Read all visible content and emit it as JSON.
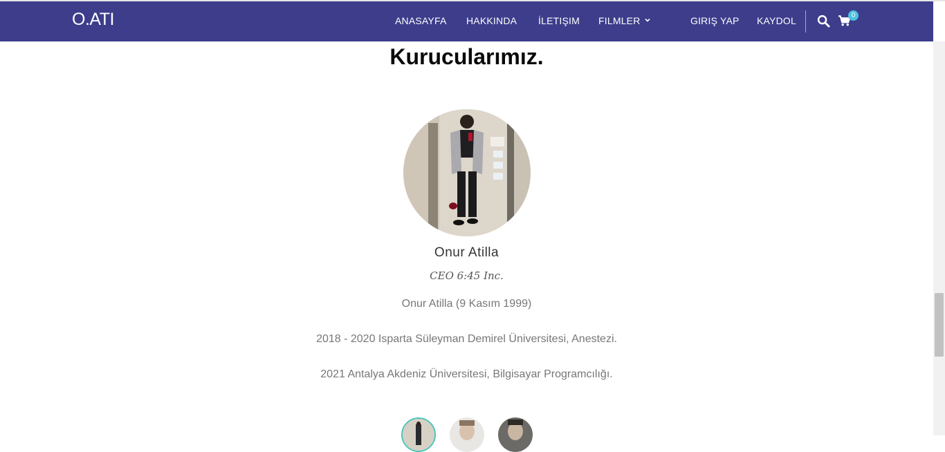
{
  "brand": {
    "logo": "O.ATI",
    "nav_color": "#3d3d8c",
    "accent": "#4cc3e0"
  },
  "nav": {
    "items": [
      {
        "label": "ANASAYFA"
      },
      {
        "label": "HAKKINDA"
      },
      {
        "label": "İLETIŞIM"
      },
      {
        "label": "FILMLER"
      }
    ],
    "login": "GIRIŞ YAP",
    "register": "KAYDOL",
    "icons": [
      "search-icon",
      "cart-icon",
      "chevron-down-icon"
    ],
    "cart_count": "0"
  },
  "section": {
    "title": "Kurucularımız.",
    "founder": {
      "name": "Onur Atilla",
      "role": "CEO 6:45 Inc.",
      "bio": [
        "Onur Atilla (9 Kasım 1999)",
        "2018 - 2020 Isparta Süleyman Demirel Üniversitesi, Anestezi.",
        "2021 Antalya Akdeniz Üniversitesi, Bilgisayar Programcılığı."
      ]
    },
    "thumbnails": [
      "founder-thumbnail-1",
      "founder-thumbnail-2",
      "founder-thumbnail-3"
    ]
  }
}
